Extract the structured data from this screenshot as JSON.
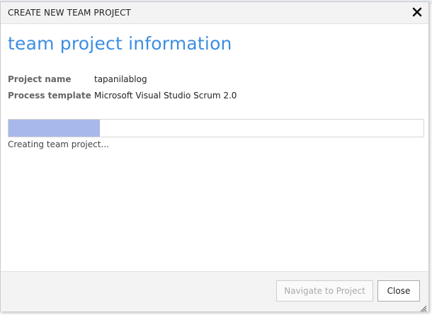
{
  "dialog": {
    "title": "CREATE NEW TEAM PROJECT",
    "close_icon": "close-icon",
    "heading": "team project information"
  },
  "fields": [
    {
      "label": "Project name",
      "value": "tapanilablog"
    },
    {
      "label": "Process template",
      "value": "Microsoft Visual Studio Scrum 2.0"
    }
  ],
  "progress": {
    "fraction": 0.22,
    "status": "Creating team project..."
  },
  "buttons": {
    "navigate_label": "Navigate to Project",
    "close_label": "Close"
  },
  "colors": {
    "heading": "#3c8ee2",
    "progress_fill": "#a9b8ea",
    "titlebar_bg": "#f3f3f3"
  }
}
